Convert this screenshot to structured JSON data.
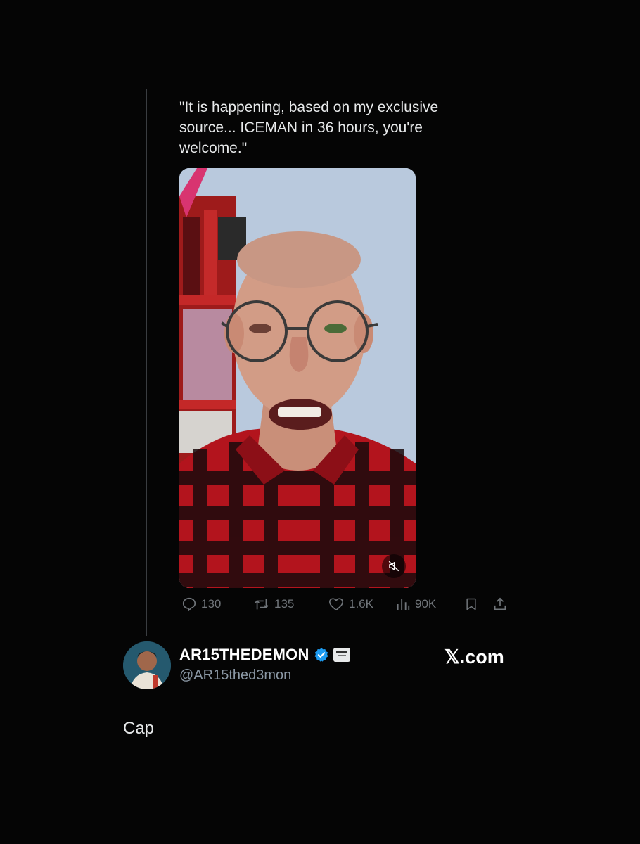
{
  "post": {
    "quote_text": "\"It is happening, based on my exclusive source... ICEMAN in 36 hours, you're welcome.\"",
    "stats": {
      "replies": "130",
      "reposts": "135",
      "likes": "1.6K",
      "views": "90K"
    }
  },
  "author": {
    "display_name": "AR15THEDEMON",
    "handle": "@AR15thed3mon",
    "verified": true
  },
  "watermark": "𝕏.com",
  "caption": "Cap",
  "icons": {
    "reply": "reply-icon",
    "repost": "repost-icon",
    "like": "heart-icon",
    "views": "views-icon",
    "bookmark": "bookmark-icon",
    "share": "share-icon",
    "mute": "mute-icon",
    "verified": "verified-badge-icon"
  },
  "colors": {
    "background": "#050505",
    "verified_blue": "#1d9bf0",
    "muted_text": "#71767b"
  }
}
